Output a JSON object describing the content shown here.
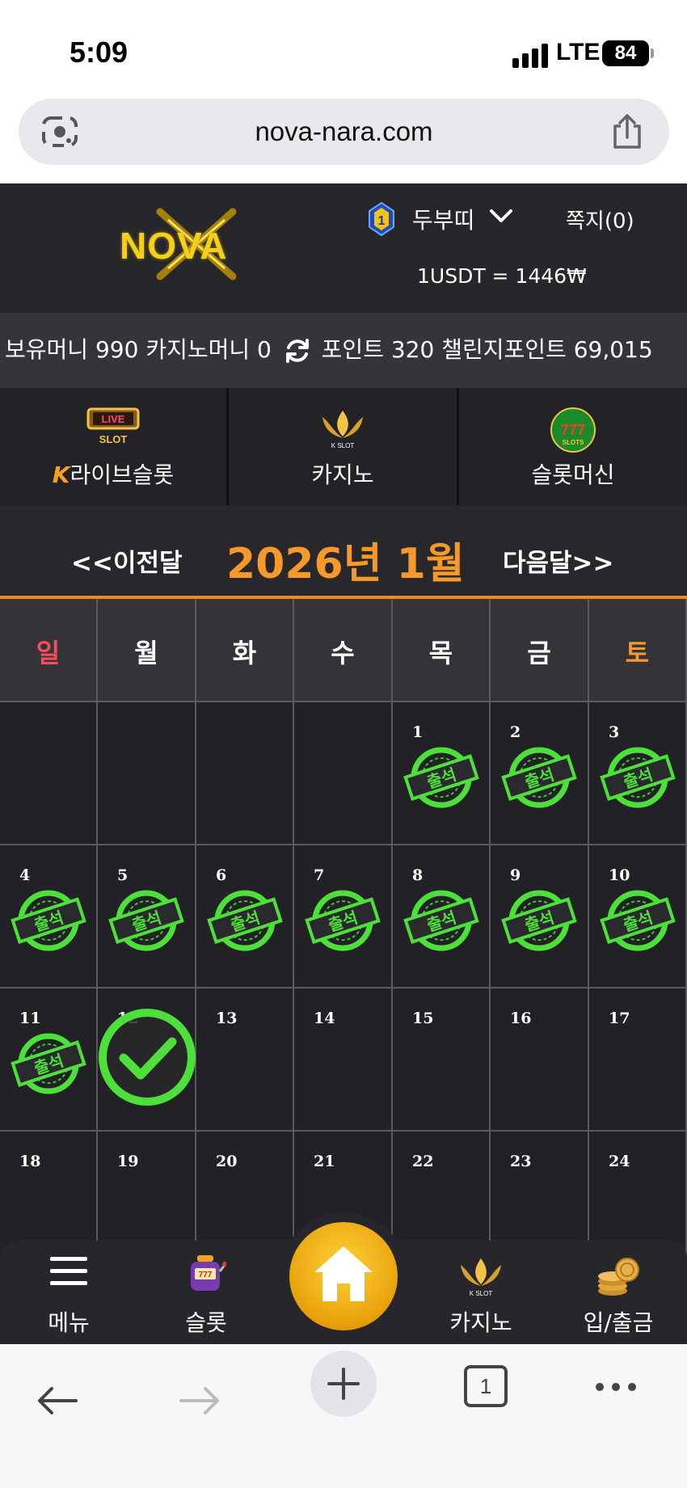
{
  "status_bar": {
    "time": "5:09",
    "network": "LTE",
    "battery": "84"
  },
  "browser": {
    "url": "nova-nara.com",
    "tab_count": "1"
  },
  "header": {
    "logo_text": "NOVA",
    "rank": "1",
    "username": "두부띠",
    "messages": "쪽지(0)",
    "exchange_rate": "1USDT = 1446₩"
  },
  "balance": {
    "money_label": "보유머니",
    "money_value": "990",
    "casino_label": "카지노머니",
    "casino_value": "0",
    "point_label": "포인트",
    "point_value": "320",
    "challenge_label": "챌린지포인트",
    "challenge_value": "69,015"
  },
  "games": [
    {
      "label": "라이브슬롯",
      "icon": "live-slot-icon",
      "badge": "K"
    },
    {
      "label": "카지노",
      "icon": "k-slot-icon"
    },
    {
      "label": "슬롯머신",
      "icon": "777-slots-icon"
    }
  ],
  "calendar": {
    "prev_label": "<<이전달",
    "title": "2026년 1월",
    "next_label": "다음달>>",
    "weekdays": [
      "일",
      "월",
      "화",
      "수",
      "목",
      "금",
      "토"
    ],
    "stamp_text": "출석",
    "rows": [
      [
        null,
        null,
        null,
        null,
        {
          "day": "1",
          "stamp": true
        },
        {
          "day": "2",
          "stamp": true
        },
        {
          "day": "3",
          "stamp": true
        }
      ],
      [
        {
          "day": "4",
          "stamp": true
        },
        {
          "day": "5",
          "stamp": true
        },
        {
          "day": "6",
          "stamp": true
        },
        {
          "day": "7",
          "stamp": true
        },
        {
          "day": "8",
          "stamp": true
        },
        {
          "day": "9",
          "stamp": true
        },
        {
          "day": "10",
          "stamp": true
        }
      ],
      [
        {
          "day": "11",
          "stamp": true
        },
        {
          "day": "12",
          "check": true
        },
        {
          "day": "13"
        },
        {
          "day": "14"
        },
        {
          "day": "15"
        },
        {
          "day": "16"
        },
        {
          "day": "17"
        }
      ],
      [
        {
          "day": "18"
        },
        {
          "day": "19"
        },
        {
          "day": "20"
        },
        {
          "day": "21"
        },
        {
          "day": "22"
        },
        {
          "day": "23"
        },
        {
          "day": "24"
        }
      ]
    ]
  },
  "bottom_nav": [
    {
      "label": "메뉴",
      "icon": "hamburger-icon"
    },
    {
      "label": "슬롯",
      "icon": "slot-machine-icon"
    },
    {
      "label": "",
      "icon": "home-icon"
    },
    {
      "label": "카지노",
      "icon": "k-slot-icon"
    },
    {
      "label": "입/출금",
      "icon": "coins-icon"
    }
  ],
  "colors": {
    "accent": "#f59a2a",
    "stamp_green": "#4ee03a",
    "sunday": "#ff4b5c",
    "saturday": "#f59a2a"
  }
}
